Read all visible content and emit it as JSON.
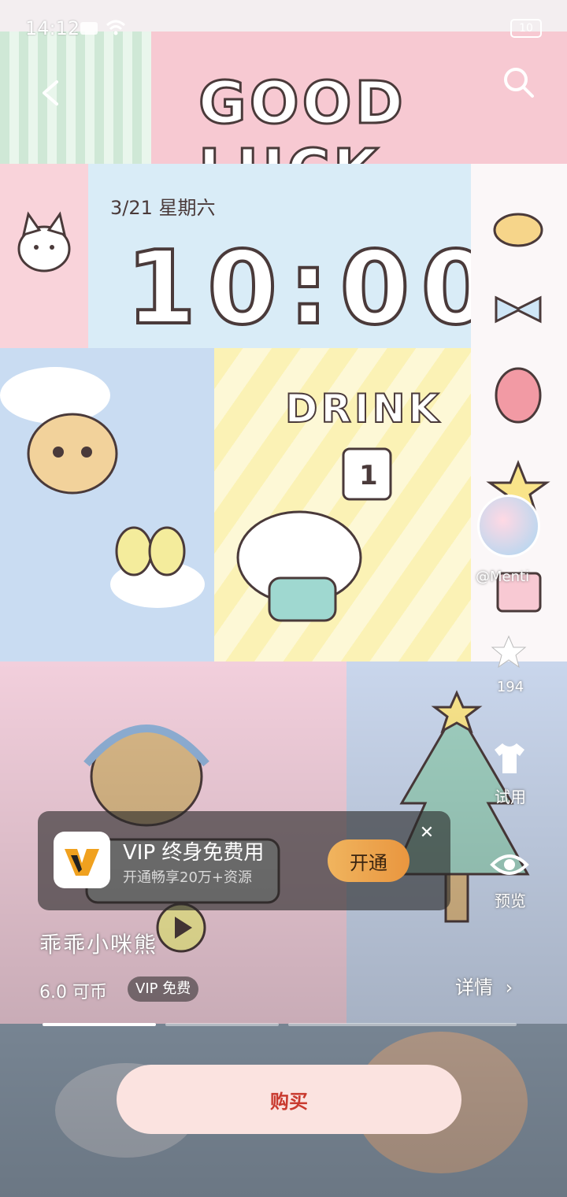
{
  "status_bar": {
    "time": "14:12",
    "battery": "10"
  },
  "wallpaper": {
    "banner_text": "GOOD LUCK",
    "date_line": "3/21 星期六",
    "clock": "10:00",
    "drink_text": "DRINK",
    "drink_count": "1"
  },
  "right_rail": {
    "author": "@Menti",
    "favorite_count": "194",
    "tryon_label": "试用",
    "preview_label": "预览"
  },
  "vip_banner": {
    "title": "VIP 终身免费用",
    "subtitle": "开通畅享20万+资源",
    "button_label": "开通",
    "close_icon": "close-icon"
  },
  "product": {
    "name": "乖乖小咪熊",
    "price": "6.0 可币",
    "vip_tag": "VIP 免费",
    "details_label": "详情"
  },
  "carousel": {
    "total": 3,
    "active_index": 0
  },
  "buy_button": {
    "label": "购买"
  },
  "colors": {
    "buy_bg": "#fbe3e0",
    "buy_text": "#c93a2f",
    "vip_btn": "#eba04a"
  }
}
